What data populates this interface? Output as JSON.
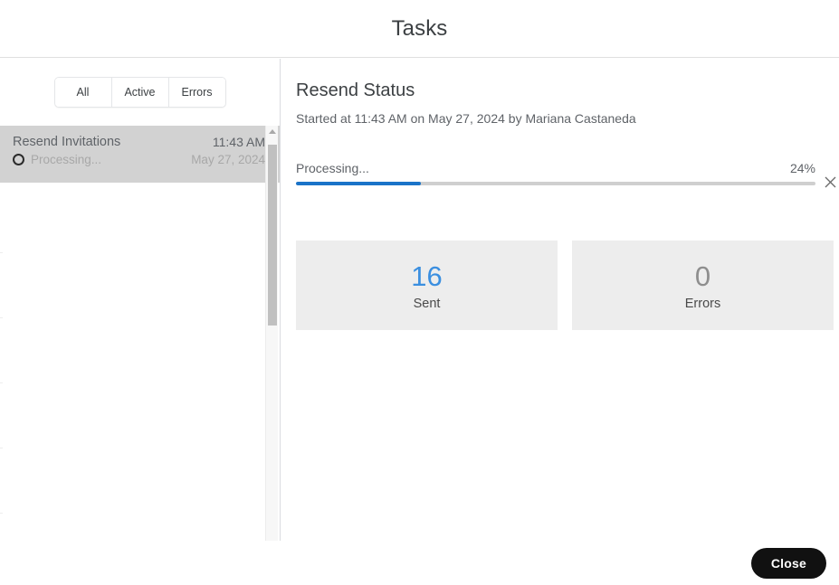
{
  "dialog": {
    "title": "Tasks",
    "close_label": "Close"
  },
  "filters": {
    "items": [
      {
        "label": "All",
        "name": "all"
      },
      {
        "label": "Active",
        "name": "active"
      },
      {
        "label": "Errors",
        "name": "errors"
      }
    ]
  },
  "task_list": {
    "rows": [
      {
        "name": "Resend Invitations",
        "time": "11:43 AM",
        "status": "Processing...",
        "date": "May 27, 2024",
        "selected": true,
        "status_icon": "spinner-icon"
      }
    ]
  },
  "detail": {
    "title": "Resend Status",
    "subtitle": "Started at 11:43 AM on May 27, 2024 by Mariana Castaneda",
    "progress": {
      "label": "Processing...",
      "percent_text": "24%",
      "percent_value": 24,
      "fill_color": "#1a73c8",
      "track_color": "#cfcfcf",
      "cancel_icon": "close-icon"
    },
    "stats": [
      {
        "value": "16",
        "label": "Sent",
        "accent": true,
        "color": "#3b8fe0"
      },
      {
        "value": "0",
        "label": "Errors",
        "accent": false,
        "color": "#8e8e8e"
      }
    ]
  },
  "scrollbar": {
    "arrow_icon": "chevron-up-icon"
  }
}
